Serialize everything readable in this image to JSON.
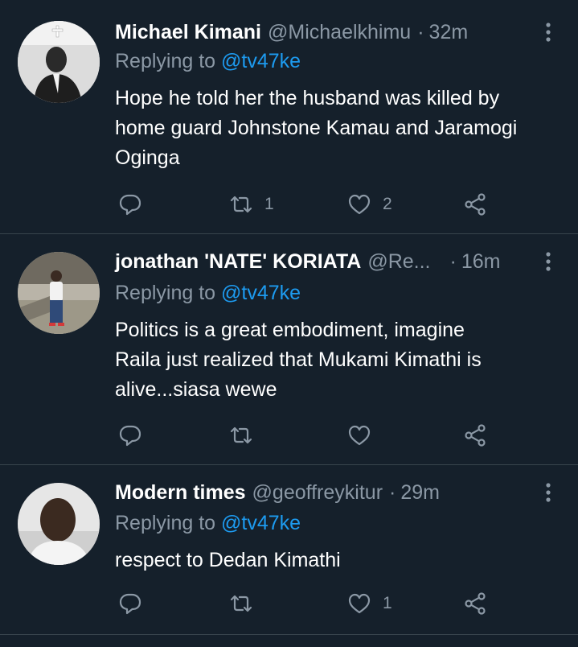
{
  "tweets": [
    {
      "name": "Michael Kimani",
      "handle": "@Michaelkhimu",
      "time": "32m",
      "replying_label": "Replying to",
      "replying_to": "@tv47ke",
      "text_lines": [
        "Hope he told her the husband was killed by",
        "home guard Johnstone Kamau and Jaramogi",
        "Oginga"
      ],
      "retweets": "1",
      "likes": "2"
    },
    {
      "name": "jonathan 'NATE' KORIATA",
      "handle": "@Re...",
      "time": "16m",
      "replying_label": "Replying to",
      "replying_to": "@tv47ke",
      "text_lines": [
        "Politics is a great embodiment, imagine",
        "Raila just realized that Mukami Kimathi is",
        "alive...siasa wewe"
      ],
      "retweets": "",
      "likes": ""
    },
    {
      "name": "Modern times",
      "handle": "@geoffreykitur",
      "time": "29m",
      "replying_label": "Replying to",
      "replying_to": "@tv47ke",
      "text_lines": [
        "respect to Dedan Kimathi"
      ],
      "retweets": "",
      "likes": "1"
    }
  ],
  "separator": "·",
  "colors": {
    "background": "#15202b",
    "text": "#ffffff",
    "muted": "#8b98a5",
    "link": "#1d9bf0",
    "divider": "#38444d"
  },
  "icons": [
    "reply-icon",
    "retweet-icon",
    "like-icon",
    "share-icon",
    "more-icon"
  ]
}
